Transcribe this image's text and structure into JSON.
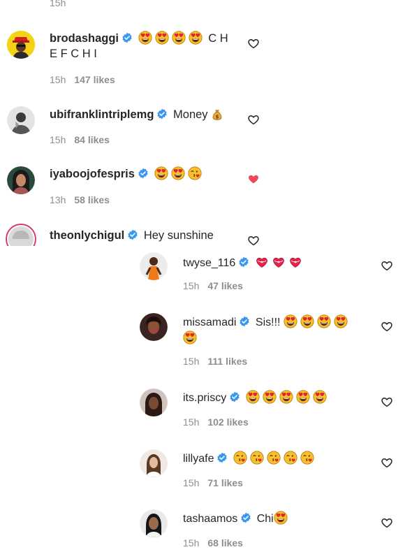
{
  "top_time": "15h",
  "comments": [
    {
      "user": "brodashaggi",
      "text": "C H",
      "text_cont": "E F C H I",
      "emojis_before": 4,
      "time": "15h",
      "likes": "147 likes",
      "liked": false
    },
    {
      "user": "ubifranklintriplemg",
      "text": "Money",
      "time": "15h",
      "likes": "84 likes",
      "liked": false
    },
    {
      "user": "iyaboojofespris",
      "text": "",
      "time": "13h",
      "likes": "58 likes",
      "liked": true
    },
    {
      "user": "theonlychigul",
      "text": "Hey sunshine",
      "liked": false
    }
  ],
  "replies": [
    {
      "user": "twyse_116",
      "text": "",
      "time": "15h",
      "likes": "47 likes",
      "liked": false
    },
    {
      "user": "missamadi",
      "text": "Sis!!!",
      "time": "15h",
      "likes": "111 likes",
      "liked": false
    },
    {
      "user": "its.priscy",
      "text": "",
      "time": "15h",
      "likes": "102 likes",
      "liked": false
    },
    {
      "user": "lillyafe",
      "text": "",
      "time": "15h",
      "likes": "71 likes",
      "liked": false
    },
    {
      "user": "tashaamos",
      "text": "Chi",
      "time": "15h",
      "likes": "68 likes",
      "liked": false
    }
  ],
  "colors": {
    "verified": "#3897f0",
    "liked_heart": "#ed4956",
    "meta": "#8e8e8e",
    "text": "#262626"
  },
  "icons": {
    "verified": "verified-badge-icon",
    "heart": "heart-icon",
    "heart_eyes": "heart-eyes-emoji",
    "kiss": "face-blowing-kiss-emoji",
    "money_bag": "money-bag-emoji",
    "heart_ribbon": "heart-with-ribbon-emoji"
  }
}
